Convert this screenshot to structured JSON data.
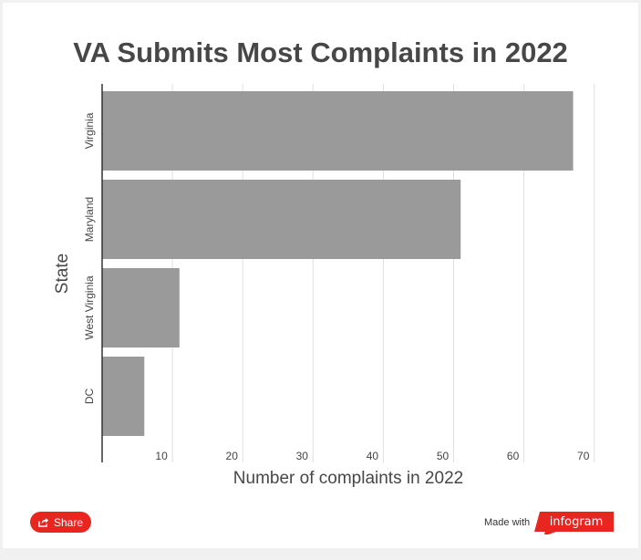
{
  "chart_data": {
    "type": "bar",
    "orientation": "horizontal",
    "title": "VA Submits Most Complaints in 2022",
    "xlabel": "Number of complaints in 2022",
    "ylabel": "State",
    "categories": [
      "Virginia",
      "Maryland",
      "West Virginia",
      "DC"
    ],
    "values": [
      67,
      51,
      11,
      6
    ],
    "xticks": [
      10,
      20,
      30,
      40,
      50,
      60,
      70
    ],
    "xlim": [
      0,
      70
    ],
    "grid": true,
    "bar_color": "#9a9a9a"
  },
  "footer": {
    "share_label": "Share",
    "made_with": "Made with",
    "brand": "infogram",
    "brand_color": "#e8261f"
  }
}
